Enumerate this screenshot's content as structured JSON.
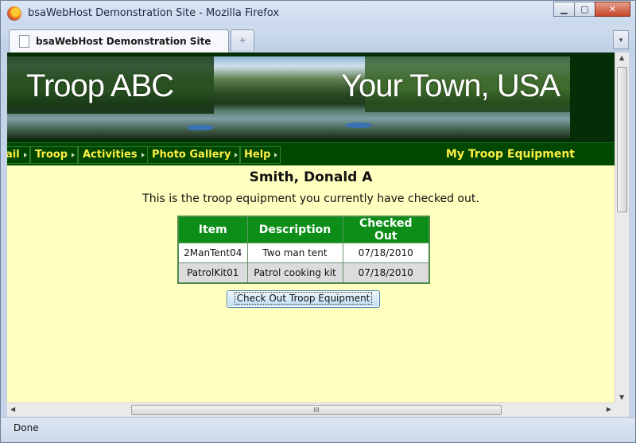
{
  "window": {
    "title": "bsaWebHost Demonstration Site - Mozilla Firefox",
    "min_glyph": "▁",
    "max_glyph": "▢",
    "close_glyph": "✕"
  },
  "tabs": [
    {
      "label": "bsaWebHost Demonstration Site"
    }
  ],
  "new_tab_glyph": "+",
  "tab_list_glyph": "▾",
  "banner": {
    "left_text": "Troop ABC",
    "right_text": "Your Town, USA"
  },
  "menu": {
    "items": [
      {
        "label": "ail"
      },
      {
        "label": "Troop"
      },
      {
        "label": "Activities"
      },
      {
        "label": "Photo Gallery"
      },
      {
        "label": "Help"
      }
    ],
    "page_heading": "My Troop Equipment"
  },
  "main": {
    "member_name": "Smith, Donald A",
    "intro": "This is the troop equipment you currently have checked out.",
    "table": {
      "headers": [
        "Item",
        "Description",
        "Checked Out"
      ],
      "rows": [
        [
          "2ManTent04",
          "Two man tent",
          "07/18/2010"
        ],
        [
          "PatrolKit01",
          "Patrol cooking kit",
          "07/18/2010"
        ]
      ]
    },
    "checkout_button": "Check Out Troop Equipment"
  },
  "scrollbars": {
    "up": "▲",
    "down": "▼",
    "left": "◀",
    "right": "▶",
    "grip": "III"
  },
  "status": {
    "text": "Done"
  },
  "colors": {
    "page_background": "#ffffc0",
    "menu_background": "#004800",
    "menu_text": "#ffee44",
    "table_header": "#0d8e18"
  },
  "icons": [
    "firefox-icon",
    "page-icon",
    "minimize-icon",
    "maximize-icon",
    "close-icon"
  ]
}
